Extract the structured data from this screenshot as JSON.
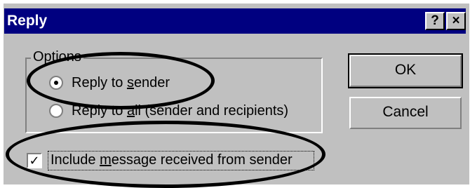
{
  "dialog": {
    "title": "Reply",
    "help_button": "?",
    "close_button": "×"
  },
  "options_group": {
    "label": "Options",
    "radios": [
      {
        "label": "Reply to sender",
        "checked": true
      },
      {
        "label": "Reply to all (sender and recipients)",
        "checked": false
      }
    ]
  },
  "include_message": {
    "label": "Include message received from sender",
    "checked": true
  },
  "buttons": {
    "ok": "OK",
    "cancel": "Cancel"
  },
  "colors": {
    "titlebar": "#000080",
    "face": "#c0c0c0",
    "annotation": "#000000"
  }
}
